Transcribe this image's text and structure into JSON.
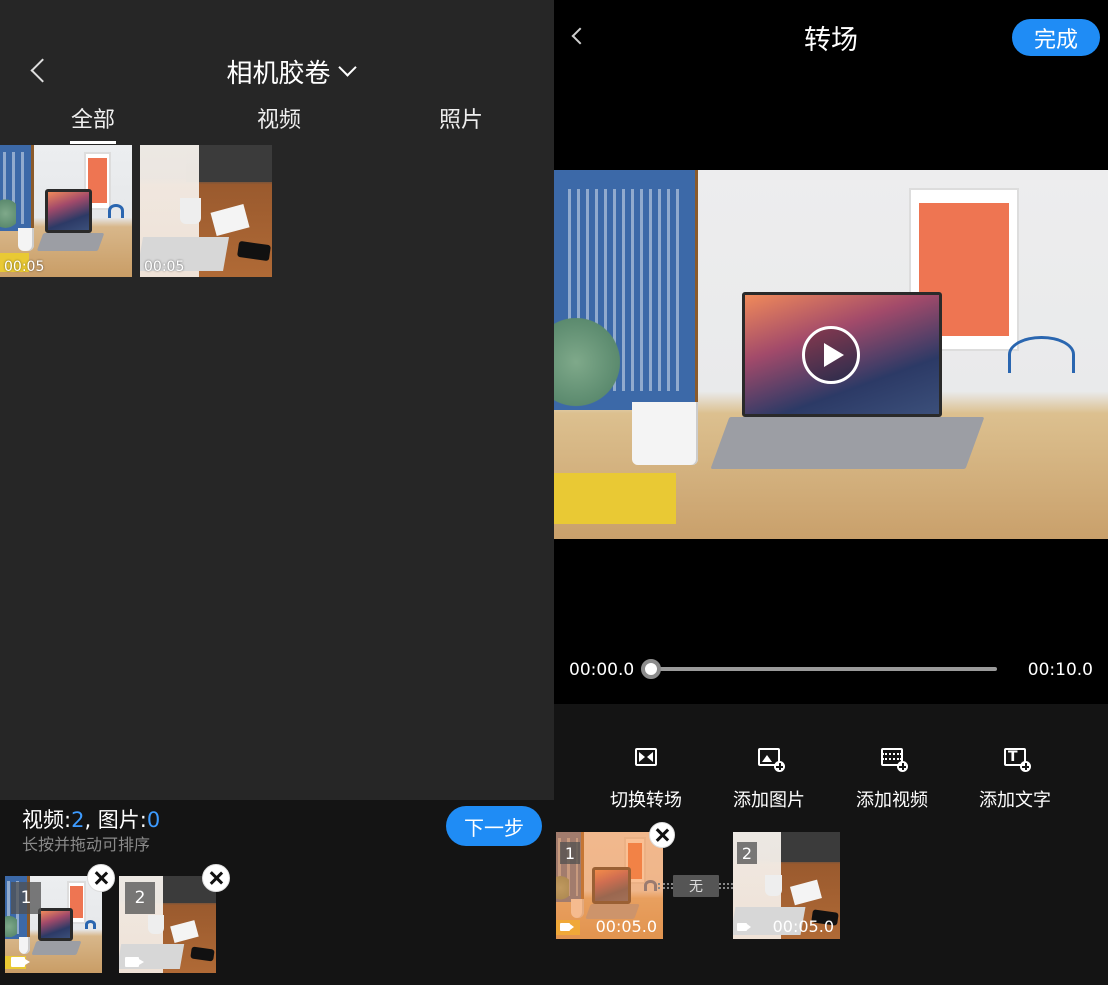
{
  "left_panel": {
    "album_title": "相机胶卷",
    "tabs": [
      {
        "label": "全部",
        "active": true
      },
      {
        "label": "视频",
        "active": false
      },
      {
        "label": "照片",
        "active": false
      }
    ],
    "grid": [
      {
        "duration": "00:05",
        "icon": "video-thumbnail"
      },
      {
        "duration": "00:05",
        "icon": "video-thumbnail"
      }
    ],
    "selection": {
      "video_label": "视频:",
      "video_count": "2",
      "separator": ", 图片:",
      "photo_count": "0",
      "hint": "长按并拖动可排序",
      "next_label": "下一步",
      "items": [
        {
          "index": "1"
        },
        {
          "index": "2"
        }
      ]
    }
  },
  "right_panel": {
    "title": "转场",
    "done_label": "完成",
    "time_current": "00:00.0",
    "time_total": "00:10.0",
    "progress_fraction": 0.0,
    "tools": [
      {
        "label": "切换转场",
        "icon": "transition-icon"
      },
      {
        "label": "添加图片",
        "icon": "add-image-icon"
      },
      {
        "label": "添加视频",
        "icon": "add-video-icon"
      },
      {
        "label": "添加文字",
        "icon": "add-text-icon"
      }
    ],
    "clips": [
      {
        "index": "1",
        "duration": "00:05.0",
        "selected": true
      },
      {
        "index": "2",
        "duration": "00:05.0",
        "selected": false
      }
    ],
    "transition_label": "无"
  },
  "colors": {
    "accent_blue": "#1f8cf5",
    "count_blue": "#3d9bff",
    "left_bg": "#262626",
    "bar_bg": "#141414",
    "selected_overlay": "#f58c3c"
  }
}
